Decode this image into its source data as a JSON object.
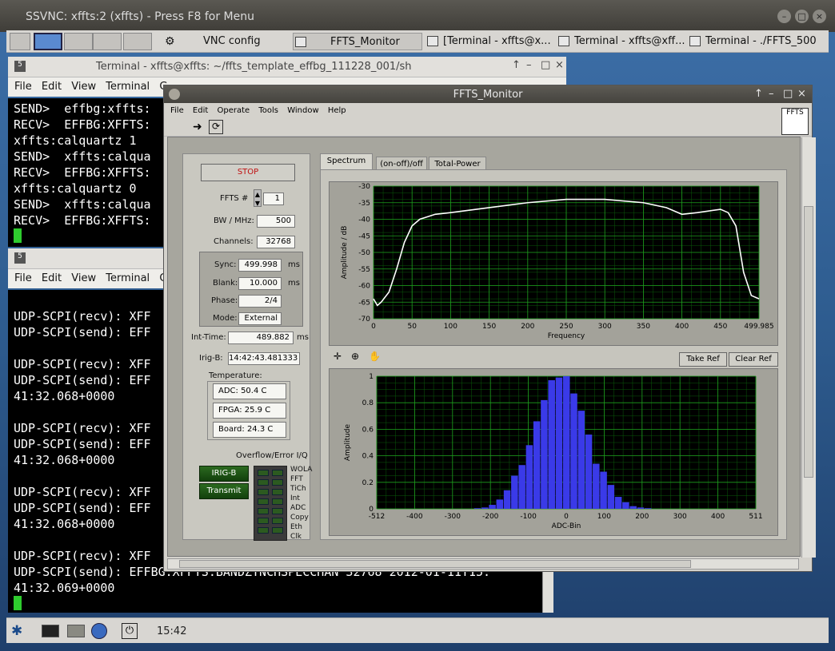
{
  "outer_window": {
    "title": "SSVNC: xffts:2 (xffts) - Press F8 for Menu",
    "vnc_config_label": "VNC config",
    "tasks": [
      "FFTS_Monitor",
      "[Terminal - xffts@x...",
      "Terminal - xffts@xff...",
      "Terminal - ./FFTS_500"
    ]
  },
  "terminal1": {
    "title": "Terminal - xffts@xffts: ~/ffts_template_effbg_111228_001/sh",
    "menu": [
      "File",
      "Edit",
      "View",
      "Terminal",
      "G"
    ],
    "lines": [
      "SEND>  effbg:xffts:",
      "RECV>  EFFBG:XFFTS:",
      "xffts:calquartz 1",
      "SEND>  xffts:calqua",
      "RECV>  EFFBG:XFFTS:",
      "xffts:calquartz 0",
      "SEND>  xffts:calqua",
      "RECV>  EFFBG:XFFTS:"
    ]
  },
  "terminal2": {
    "menu": [
      "File",
      "Edit",
      "View",
      "Terminal",
      "G"
    ],
    "lines": [
      "UDP-SCPI(recv): XFF",
      "UDP-SCPI(send): EFF",
      "",
      "UDP-SCPI(recv): XFF",
      "UDP-SCPI(send): EFF",
      "41:32.068+0000",
      "",
      "UDP-SCPI(recv): XFF",
      "UDP-SCPI(send): EFF",
      "41:32.068+0000",
      "",
      "UDP-SCPI(recv): XFF",
      "UDP-SCPI(send): EFF",
      "41:32.068+0000",
      "",
      "UDP-SCPI(recv): XFF",
      "UDP-SCPI(send): EFFBG:XFFTS:BANDZTNCHSPECCHAN 32768 2012-01-11T15:",
      "41:32.069+0000"
    ]
  },
  "ffts_monitor": {
    "title": "FFTS_Monitor",
    "menu": [
      "File",
      "Edit",
      "Operate",
      "Tools",
      "Window",
      "Help"
    ],
    "logo_text": "FFTS",
    "stop_label": "STOP",
    "ffts_num_label": "FFTS #",
    "ffts_num": "1",
    "bw_label": "BW / MHz:",
    "bw": "500",
    "channels_label": "Channels:",
    "channels": "32768",
    "sync_label": "Sync:",
    "sync": "499.998",
    "blank_label": "Blank:",
    "blank": "10.000",
    "ms_unit": "ms",
    "phase_label": "Phase:",
    "phase": "2/4",
    "mode_label": "Mode:",
    "mode": "External",
    "inttime_label": "Int-Time:",
    "inttime": "489.882",
    "irigb_label": "Irig-B:",
    "irigb": "14:42:43.481333",
    "temp_label": "Temperature:",
    "adc_temp": "ADC: 50.4 C",
    "fpga_temp": "FPGA: 25.9 C",
    "board_temp": "Board: 24.3 C",
    "overflow_label": "Overflow/Error I/Q",
    "irigb_btn": "IRIG-B",
    "transmit_btn": "Transmit",
    "status_leds": [
      "WOLA",
      "FFT",
      "TiCh",
      "Int",
      "ADC",
      "Copy",
      "Eth",
      "Clk"
    ],
    "tabs": [
      "Spectrum",
      "(on-off)/off",
      "Total-Power"
    ],
    "take_ref": "Take Ref",
    "clear_ref": "Clear Ref"
  },
  "chart_data": [
    {
      "type": "line",
      "xlabel": "Frequency",
      "ylabel": "Amplitude / dB",
      "xlim": [
        0,
        499.985
      ],
      "ylim": [
        -70,
        -30
      ],
      "x_ticks": [
        "0",
        "50",
        "100",
        "150",
        "200",
        "250",
        "300",
        "350",
        "400",
        "450",
        "499.985"
      ],
      "y_ticks": [
        "-30",
        "-35",
        "-40",
        "-45",
        "-50",
        "-55",
        "-60",
        "-65",
        "-70"
      ],
      "grid": true,
      "x": [
        0,
        5,
        10,
        20,
        30,
        40,
        50,
        60,
        80,
        100,
        150,
        200,
        250,
        300,
        350,
        380,
        400,
        420,
        450,
        460,
        470,
        480,
        490,
        499.985
      ],
      "y": [
        -64,
        -66,
        -65,
        -62,
        -55,
        -47,
        -42,
        -40,
        -38.5,
        -38,
        -36.5,
        -35,
        -34,
        -34,
        -35,
        -36.5,
        -38.5,
        -38,
        -37,
        -38,
        -42,
        -56,
        -63,
        -64
      ]
    },
    {
      "type": "bar",
      "xlabel": "ADC-Bin",
      "ylabel": "Amplitude",
      "xlim": [
        -512,
        511
      ],
      "ylim": [
        0,
        1
      ],
      "x_ticks": [
        "-512",
        "-400",
        "-300",
        "-200",
        "-100",
        "0",
        "100",
        "200",
        "300",
        "400",
        "511"
      ],
      "y_ticks": [
        "1",
        "0.8",
        "0.6",
        "0.4",
        "0.2",
        "0"
      ],
      "grid": true,
      "bar_color": "#3a3ae8",
      "x": [
        -240,
        -220,
        -200,
        -180,
        -160,
        -140,
        -120,
        -100,
        -80,
        -60,
        -40,
        -20,
        0,
        20,
        40,
        60,
        80,
        100,
        120,
        140,
        160,
        180,
        200,
        220
      ],
      "values": [
        0.005,
        0.01,
        0.03,
        0.07,
        0.14,
        0.25,
        0.33,
        0.48,
        0.66,
        0.82,
        0.97,
        0.99,
        1.0,
        0.87,
        0.74,
        0.56,
        0.34,
        0.28,
        0.18,
        0.09,
        0.05,
        0.02,
        0.01,
        0.005
      ]
    }
  ],
  "taskbar": {
    "clock": "15:42"
  }
}
